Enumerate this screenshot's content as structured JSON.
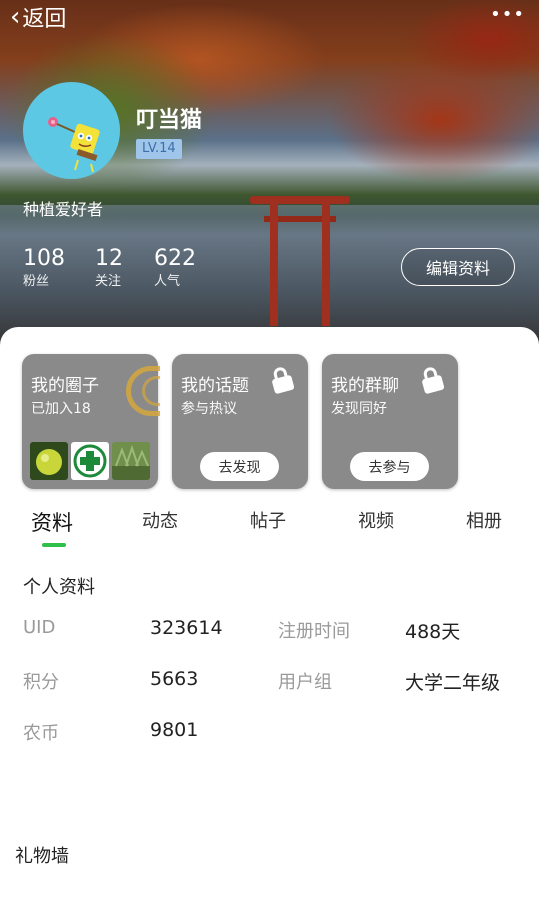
{
  "header": {
    "back_label": "返回",
    "more_label": "•••"
  },
  "profile": {
    "name": "叮当猫",
    "level": "LV.14",
    "bio": "种植爱好者",
    "edit_label": "编辑资料",
    "stats": [
      {
        "value": "108",
        "label": "粉丝"
      },
      {
        "value": "12",
        "label": "关注"
      },
      {
        "value": "622",
        "label": "人气"
      }
    ]
  },
  "cards": [
    {
      "title": "我的圈子",
      "subtitle": "已加入18"
    },
    {
      "title": "我的话题",
      "subtitle": "参与热议",
      "button": "去发现"
    },
    {
      "title": "我的群聊",
      "subtitle": "发现同好",
      "button": "去参与"
    }
  ],
  "tabs": [
    "资料",
    "动态",
    "帖子",
    "视频",
    "相册"
  ],
  "info": {
    "title": "个人资料",
    "fields": [
      {
        "label": "UID",
        "value": "323614"
      },
      {
        "label": "注册时间",
        "value": "488天"
      },
      {
        "label": "积分",
        "value": "5663"
      },
      {
        "label": "用户组",
        "value": "大学二年级"
      },
      {
        "label": "农币",
        "value": "9801"
      }
    ]
  },
  "gift_wall": {
    "title": "礼物墙"
  },
  "colors": {
    "accent": "#2fbf4a",
    "card_bg": "#8a8a8a",
    "level_bg": "#9fc6ea"
  }
}
